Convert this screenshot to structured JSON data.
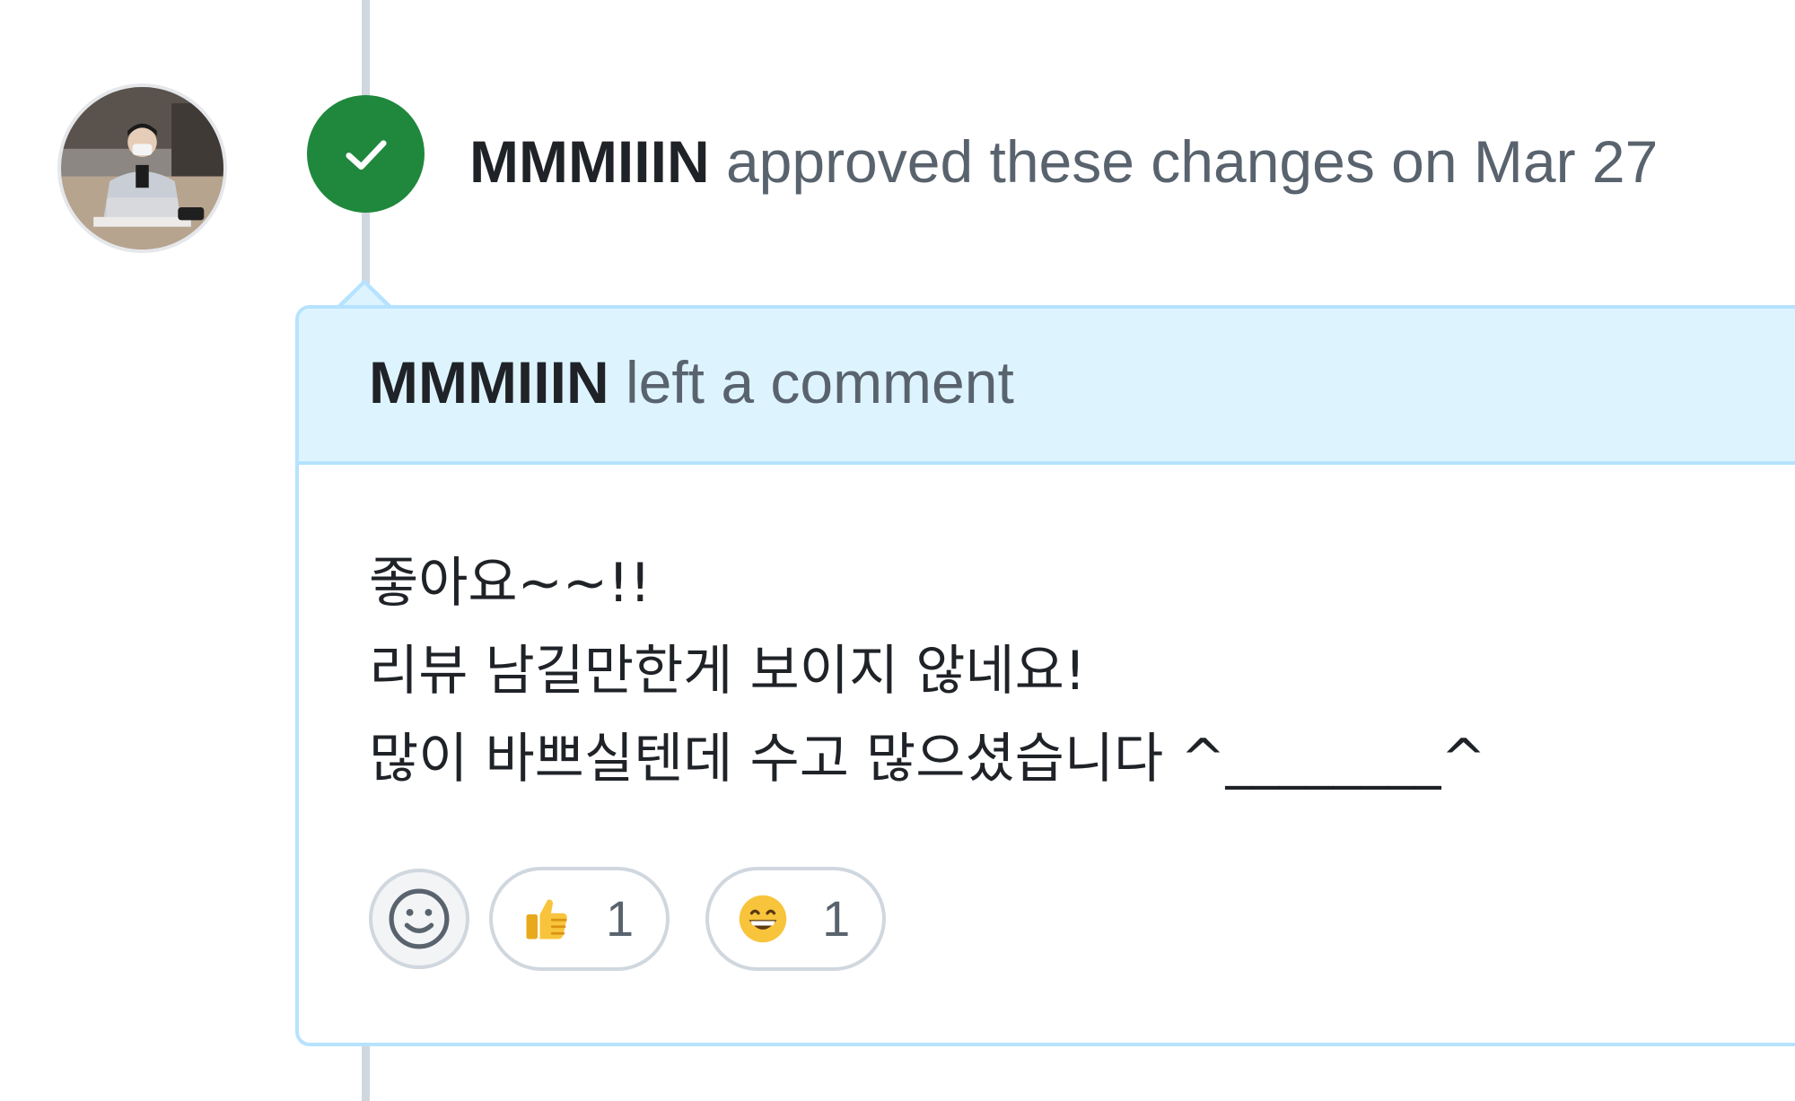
{
  "timeline_event": {
    "author": "MMMIIIN",
    "action_text": "approved these changes on Mar 27"
  },
  "comment": {
    "author": "MMMIIIN",
    "action_text": "left a comment",
    "body_lines": [
      "좋아요~~!!",
      "리뷰 남길만한게 보이지 않네요!",
      "많이 바쁘실텐데 수고 많으셨습니다 ^________^"
    ]
  },
  "reactions": [
    {
      "emoji": "thumbs-up-icon",
      "count": "1"
    },
    {
      "emoji": "grinning-face-icon",
      "count": "1"
    }
  ],
  "colors": {
    "approve_green": "#1f883d",
    "header_bg": "#ddf4ff",
    "border_blue": "#b6e3ff",
    "muted_text": "#59636e",
    "primary_text": "#1f2328"
  }
}
